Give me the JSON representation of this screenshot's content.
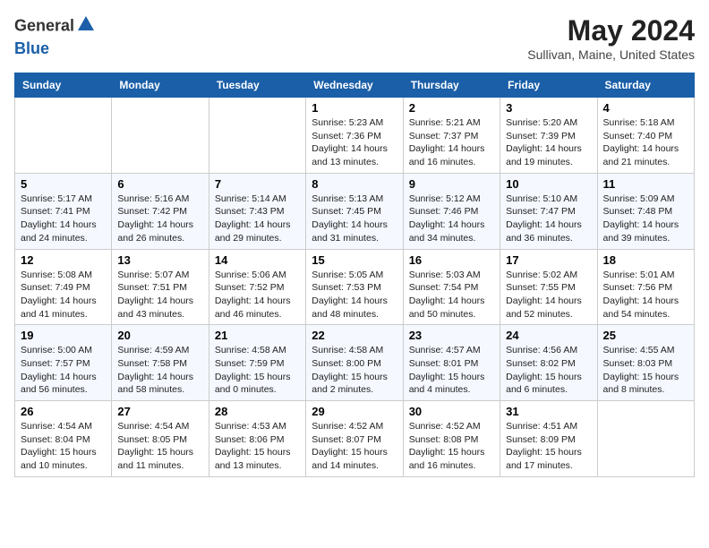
{
  "header": {
    "logo_line1": "General",
    "logo_line2": "Blue",
    "month_year": "May 2024",
    "location": "Sullivan, Maine, United States"
  },
  "weekdays": [
    "Sunday",
    "Monday",
    "Tuesday",
    "Wednesday",
    "Thursday",
    "Friday",
    "Saturday"
  ],
  "weeks": [
    [
      {
        "day": "",
        "info": ""
      },
      {
        "day": "",
        "info": ""
      },
      {
        "day": "",
        "info": ""
      },
      {
        "day": "1",
        "info": "Sunrise: 5:23 AM\nSunset: 7:36 PM\nDaylight: 14 hours\nand 13 minutes."
      },
      {
        "day": "2",
        "info": "Sunrise: 5:21 AM\nSunset: 7:37 PM\nDaylight: 14 hours\nand 16 minutes."
      },
      {
        "day": "3",
        "info": "Sunrise: 5:20 AM\nSunset: 7:39 PM\nDaylight: 14 hours\nand 19 minutes."
      },
      {
        "day": "4",
        "info": "Sunrise: 5:18 AM\nSunset: 7:40 PM\nDaylight: 14 hours\nand 21 minutes."
      }
    ],
    [
      {
        "day": "5",
        "info": "Sunrise: 5:17 AM\nSunset: 7:41 PM\nDaylight: 14 hours\nand 24 minutes."
      },
      {
        "day": "6",
        "info": "Sunrise: 5:16 AM\nSunset: 7:42 PM\nDaylight: 14 hours\nand 26 minutes."
      },
      {
        "day": "7",
        "info": "Sunrise: 5:14 AM\nSunset: 7:43 PM\nDaylight: 14 hours\nand 29 minutes."
      },
      {
        "day": "8",
        "info": "Sunrise: 5:13 AM\nSunset: 7:45 PM\nDaylight: 14 hours\nand 31 minutes."
      },
      {
        "day": "9",
        "info": "Sunrise: 5:12 AM\nSunset: 7:46 PM\nDaylight: 14 hours\nand 34 minutes."
      },
      {
        "day": "10",
        "info": "Sunrise: 5:10 AM\nSunset: 7:47 PM\nDaylight: 14 hours\nand 36 minutes."
      },
      {
        "day": "11",
        "info": "Sunrise: 5:09 AM\nSunset: 7:48 PM\nDaylight: 14 hours\nand 39 minutes."
      }
    ],
    [
      {
        "day": "12",
        "info": "Sunrise: 5:08 AM\nSunset: 7:49 PM\nDaylight: 14 hours\nand 41 minutes."
      },
      {
        "day": "13",
        "info": "Sunrise: 5:07 AM\nSunset: 7:51 PM\nDaylight: 14 hours\nand 43 minutes."
      },
      {
        "day": "14",
        "info": "Sunrise: 5:06 AM\nSunset: 7:52 PM\nDaylight: 14 hours\nand 46 minutes."
      },
      {
        "day": "15",
        "info": "Sunrise: 5:05 AM\nSunset: 7:53 PM\nDaylight: 14 hours\nand 48 minutes."
      },
      {
        "day": "16",
        "info": "Sunrise: 5:03 AM\nSunset: 7:54 PM\nDaylight: 14 hours\nand 50 minutes."
      },
      {
        "day": "17",
        "info": "Sunrise: 5:02 AM\nSunset: 7:55 PM\nDaylight: 14 hours\nand 52 minutes."
      },
      {
        "day": "18",
        "info": "Sunrise: 5:01 AM\nSunset: 7:56 PM\nDaylight: 14 hours\nand 54 minutes."
      }
    ],
    [
      {
        "day": "19",
        "info": "Sunrise: 5:00 AM\nSunset: 7:57 PM\nDaylight: 14 hours\nand 56 minutes."
      },
      {
        "day": "20",
        "info": "Sunrise: 4:59 AM\nSunset: 7:58 PM\nDaylight: 14 hours\nand 58 minutes."
      },
      {
        "day": "21",
        "info": "Sunrise: 4:58 AM\nSunset: 7:59 PM\nDaylight: 15 hours\nand 0 minutes."
      },
      {
        "day": "22",
        "info": "Sunrise: 4:58 AM\nSunset: 8:00 PM\nDaylight: 15 hours\nand 2 minutes."
      },
      {
        "day": "23",
        "info": "Sunrise: 4:57 AM\nSunset: 8:01 PM\nDaylight: 15 hours\nand 4 minutes."
      },
      {
        "day": "24",
        "info": "Sunrise: 4:56 AM\nSunset: 8:02 PM\nDaylight: 15 hours\nand 6 minutes."
      },
      {
        "day": "25",
        "info": "Sunrise: 4:55 AM\nSunset: 8:03 PM\nDaylight: 15 hours\nand 8 minutes."
      }
    ],
    [
      {
        "day": "26",
        "info": "Sunrise: 4:54 AM\nSunset: 8:04 PM\nDaylight: 15 hours\nand 10 minutes."
      },
      {
        "day": "27",
        "info": "Sunrise: 4:54 AM\nSunset: 8:05 PM\nDaylight: 15 hours\nand 11 minutes."
      },
      {
        "day": "28",
        "info": "Sunrise: 4:53 AM\nSunset: 8:06 PM\nDaylight: 15 hours\nand 13 minutes."
      },
      {
        "day": "29",
        "info": "Sunrise: 4:52 AM\nSunset: 8:07 PM\nDaylight: 15 hours\nand 14 minutes."
      },
      {
        "day": "30",
        "info": "Sunrise: 4:52 AM\nSunset: 8:08 PM\nDaylight: 15 hours\nand 16 minutes."
      },
      {
        "day": "31",
        "info": "Sunrise: 4:51 AM\nSunset: 8:09 PM\nDaylight: 15 hours\nand 17 minutes."
      },
      {
        "day": "",
        "info": ""
      }
    ]
  ]
}
